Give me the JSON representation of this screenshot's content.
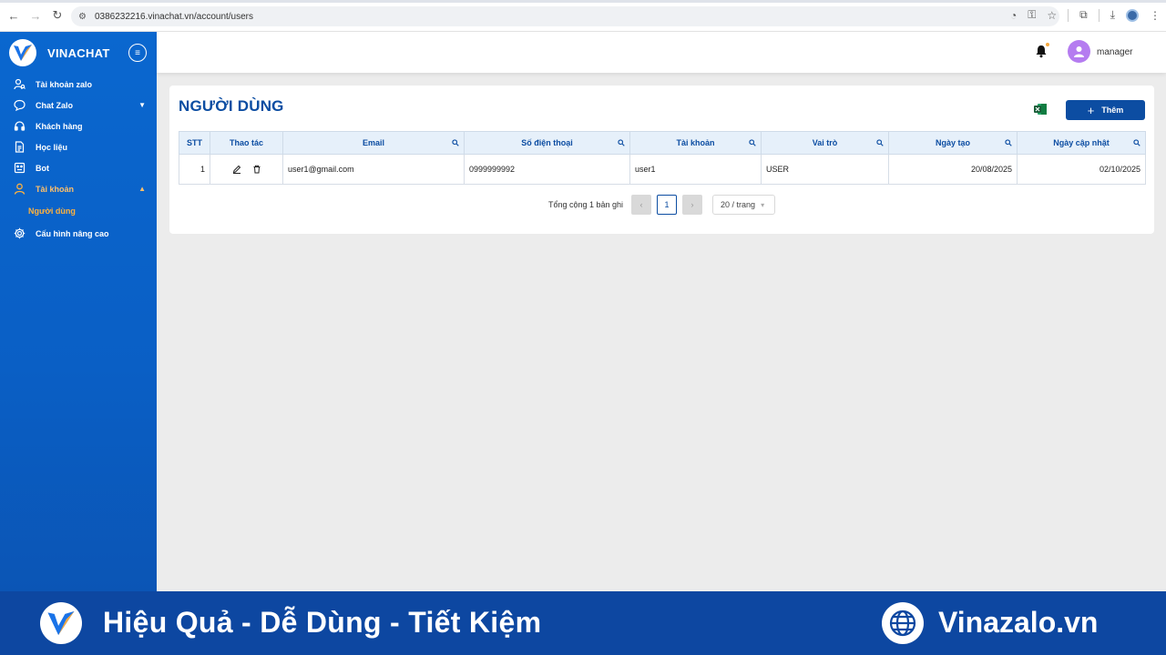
{
  "browser": {
    "url": "0386232216.vinachat.vn/account/users"
  },
  "sidebar": {
    "brand": "VINACHAT",
    "items": [
      {
        "label": "Tài khoản zalo",
        "icon": "user-search-icon"
      },
      {
        "label": "Chat Zalo",
        "icon": "chat-icon",
        "chevron": "down"
      },
      {
        "label": "Khách hàng",
        "icon": "headset-icon"
      },
      {
        "label": "Học liệu",
        "icon": "document-icon"
      },
      {
        "label": "Bot",
        "icon": "bot-icon"
      },
      {
        "label": "Tài khoản",
        "icon": "user-icon",
        "chevron": "up",
        "active": true
      },
      {
        "label": "Người dùng",
        "sub": true
      },
      {
        "label": "Cấu hình nâng cao",
        "icon": "gear-icon"
      }
    ]
  },
  "header": {
    "username": "manager"
  },
  "page": {
    "title": "NGƯỜI DÙNG",
    "add_label": "Thêm"
  },
  "table": {
    "columns": [
      "STT",
      "Thao tác",
      "Email",
      "Số điện thoại",
      "Tài khoản",
      "Vai trò",
      "Ngày tạo",
      "Ngày cập nhật"
    ],
    "rows": [
      {
        "stt": "1",
        "email": "user1@gmail.com",
        "phone": "0999999992",
        "account": "user1",
        "role": "USER",
        "created": "20/08/2025",
        "updated": "02/10/2025"
      }
    ]
  },
  "pagination": {
    "total": "Tổng cộng 1 bản ghi",
    "current": "1",
    "page_size": "20 / trang"
  },
  "banner": {
    "slogan": "Hiệu Quả - Dễ Dùng - Tiết Kiệm",
    "site": "Vinazalo.vn"
  },
  "colors": {
    "primary": "#0c4da2",
    "sidebar": "#0a67cf",
    "accent": "#ffb23e"
  }
}
